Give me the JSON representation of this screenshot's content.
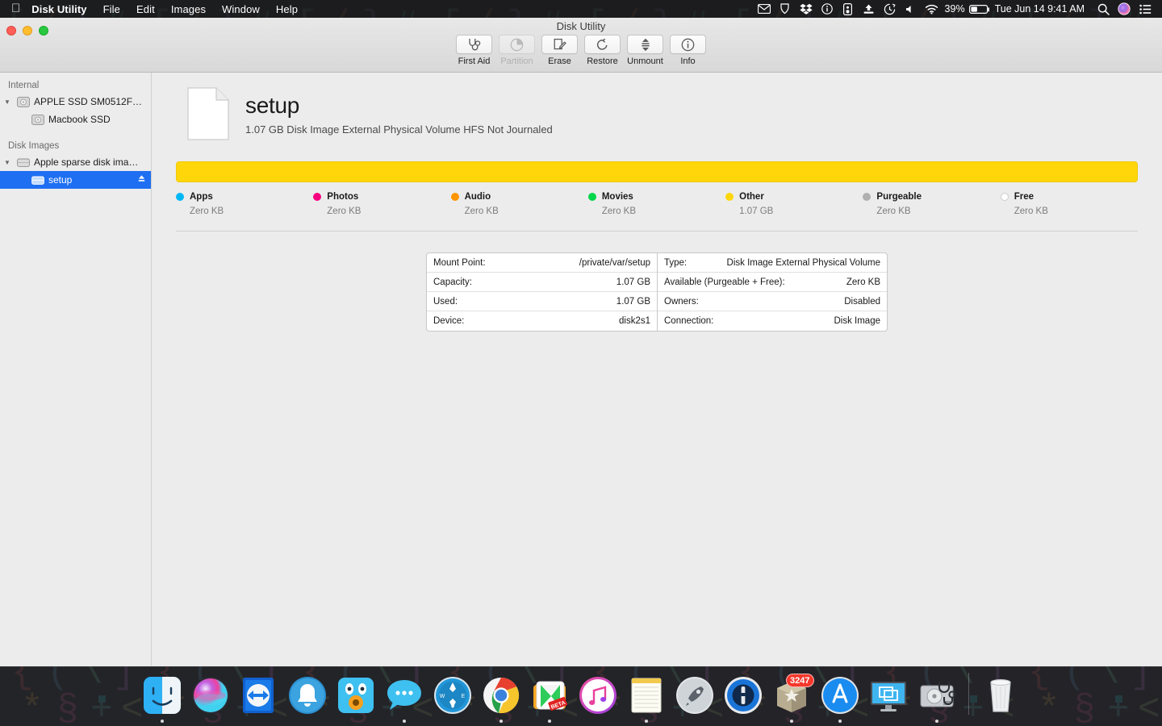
{
  "menubar": {
    "apple_icon": "apple-logo",
    "items": [
      {
        "label": "Disk Utility",
        "bold": true
      },
      {
        "label": "File",
        "bold": false
      },
      {
        "label": "Edit",
        "bold": false
      },
      {
        "label": "Images",
        "bold": false
      },
      {
        "label": "Window",
        "bold": false
      },
      {
        "label": "Help",
        "bold": false
      }
    ],
    "status_icons": [
      "mail-icon",
      "vpn-shield-icon",
      "dropbox-icon",
      "info-circle-icon",
      "phone-icon",
      "airdrop-icon",
      "time-machine-icon",
      "volume-icon",
      "wifi-icon"
    ],
    "battery_percent": "39%",
    "battery_icon": "battery-icon",
    "clock": "Tue Jun 14  9:41 AM",
    "search_icon": "spotlight-search-icon",
    "siri_icon": "siri-icon",
    "notification_icon": "notification-center-icon"
  },
  "window": {
    "title": "Disk Utility",
    "traffic_lights": [
      "close-button",
      "minimize-button",
      "zoom-button"
    ],
    "toolbar": [
      {
        "label": "First Aid",
        "icon": "stethoscope-icon",
        "disabled": false
      },
      {
        "label": "Partition",
        "icon": "pie-chart-icon",
        "disabled": true
      },
      {
        "label": "Erase",
        "icon": "erase-pencil-icon",
        "disabled": false
      },
      {
        "label": "Restore",
        "icon": "restore-arrow-icon",
        "disabled": false
      },
      {
        "label": "Unmount",
        "icon": "unmount-eject-icon",
        "disabled": false
      },
      {
        "label": "Info",
        "icon": "info-circle-icon",
        "disabled": false
      }
    ]
  },
  "sidebar": {
    "sections": [
      {
        "header": "Internal",
        "rows": [
          {
            "label": "APPLE SSD SM0512F…",
            "icon": "hard-disk-icon",
            "level": 0,
            "expandable": true,
            "selected": false,
            "eject": false
          },
          {
            "label": "Macbook SSD",
            "icon": "hard-disk-icon",
            "level": 1,
            "expandable": false,
            "selected": false,
            "eject": false
          }
        ]
      },
      {
        "header": "Disk Images",
        "rows": [
          {
            "label": "Apple sparse disk ima…",
            "icon": "disk-image-icon",
            "level": 0,
            "expandable": true,
            "selected": false,
            "eject": false
          },
          {
            "label": "setup",
            "icon": "volume-icon",
            "level": 1,
            "expandable": false,
            "selected": true,
            "eject": true
          }
        ]
      }
    ]
  },
  "volume": {
    "icon": "document-page-icon",
    "name": "setup",
    "subtitle": "1.07 GB Disk Image External Physical Volume HFS Not Journaled"
  },
  "chart_data": {
    "type": "bar",
    "title": "Storage usage for setup",
    "total_capacity": "1.07 GB",
    "categories": [
      "Apps",
      "Photos",
      "Audio",
      "Movies",
      "Other",
      "Purgeable",
      "Free"
    ],
    "values": [
      "Zero KB",
      "Zero KB",
      "Zero KB",
      "Zero KB",
      "1.07 GB",
      "Zero KB",
      "Zero KB"
    ],
    "numeric_bytes": [
      0,
      0,
      0,
      0,
      1070000000,
      0,
      0
    ],
    "fractions": [
      0,
      0,
      0,
      0,
      1.0,
      0,
      0
    ],
    "colors": [
      "#00b7f5",
      "#f5007e",
      "#ff9500",
      "#00d74a",
      "#ffd60a",
      "#b0b0b0",
      "#ffffff"
    ],
    "legend_position": "below",
    "grid": false
  },
  "info": {
    "left": [
      {
        "key": "Mount Point:",
        "value": "/private/var/setup"
      },
      {
        "key": "Capacity:",
        "value": "1.07 GB"
      },
      {
        "key": "Used:",
        "value": "1.07 GB"
      },
      {
        "key": "Device:",
        "value": "disk2s1"
      }
    ],
    "right": [
      {
        "key": "Type:",
        "value": "Disk Image External Physical Volume"
      },
      {
        "key": "Available (Purgeable + Free):",
        "value": "Zero KB"
      },
      {
        "key": "Owners:",
        "value": "Disabled"
      },
      {
        "key": "Connection:",
        "value": "Disk Image"
      }
    ]
  },
  "dock": {
    "items": [
      {
        "name": "finder",
        "running": true
      },
      {
        "name": "siri",
        "running": false
      },
      {
        "name": "teamviewer",
        "running": false
      },
      {
        "name": "bell-app",
        "running": false
      },
      {
        "name": "tweetbot",
        "running": false
      },
      {
        "name": "messages",
        "running": true
      },
      {
        "name": "safari",
        "running": false
      },
      {
        "name": "chrome",
        "running": true
      },
      {
        "name": "kiwi-mail-beta",
        "running": true
      },
      {
        "name": "itunes",
        "running": false
      },
      {
        "name": "notes",
        "running": true
      },
      {
        "name": "launchpad",
        "running": false
      },
      {
        "name": "onepassword",
        "running": false
      },
      {
        "name": "package-app",
        "running": true,
        "badge": "3247"
      },
      {
        "name": "app-store",
        "running": true
      },
      {
        "name": "mission-control",
        "running": false
      },
      {
        "name": "disk-utility",
        "running": true
      },
      {
        "name": "trash",
        "running": false
      }
    ]
  }
}
